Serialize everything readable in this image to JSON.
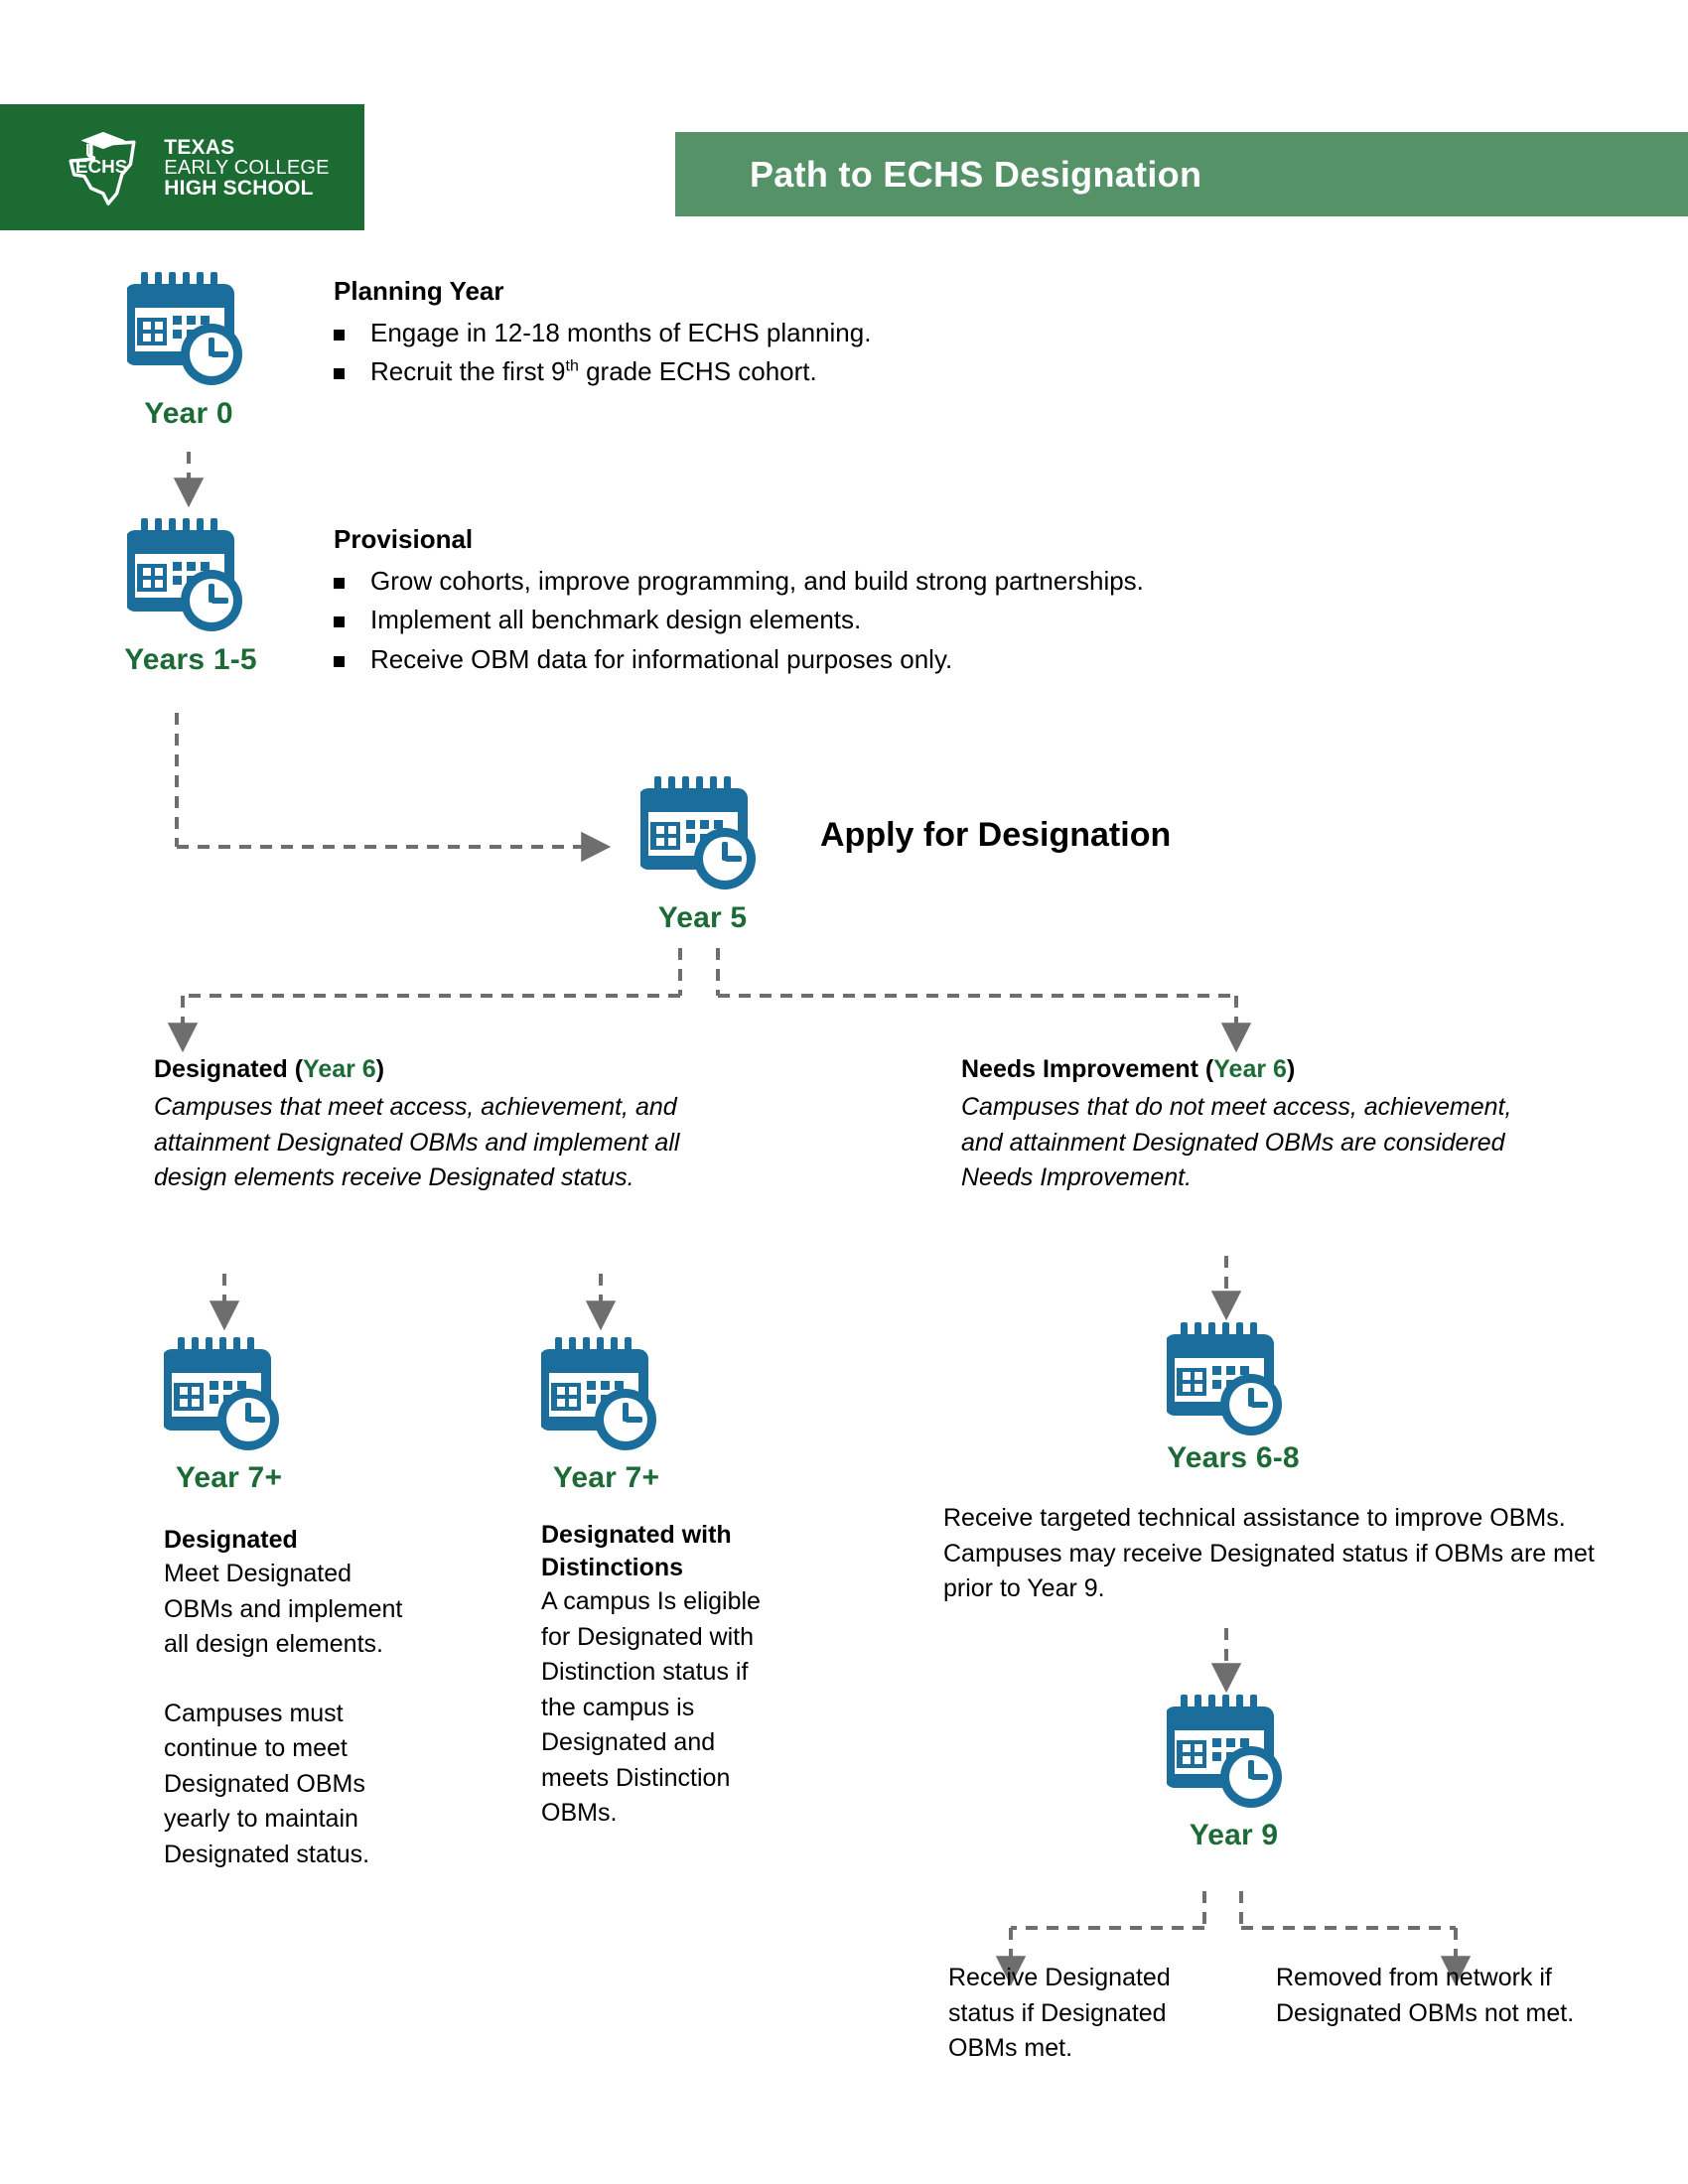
{
  "colors": {
    "logo_green": "#1B6B33",
    "header_green": "#559268",
    "year_green": "#1C6B36",
    "icon_blue": "#1B6E9B",
    "connector_gray": "#6E6E6E"
  },
  "logo": {
    "mark_label": "texas-echs-logo",
    "badge_text": "ECHS",
    "line1": "TEXAS",
    "line2": "EARLY COLLEGE",
    "line3": "HIGH SCHOOL"
  },
  "header": {
    "title": "Path to ECHS Designation"
  },
  "stages": {
    "year0": {
      "icon": "calendar-clock-icon",
      "year_label": "Year 0",
      "heading": "Planning Year",
      "bullets": [
        "Engage in 12-18 months of ECHS planning.",
        "Recruit the first 9th grade ECHS cohort."
      ],
      "bullet2_prefix": "Recruit the first 9",
      "bullet2_sup": "th",
      "bullet2_suffix": " grade ECHS cohort."
    },
    "provisional": {
      "icon": "calendar-clock-icon",
      "year_label": "Years 1-5",
      "heading": "Provisional",
      "bullets": [
        "Grow cohorts, improve programming, and build strong partnerships.",
        "Implement all benchmark design elements.",
        "Receive OBM data for informational purposes only."
      ]
    },
    "apply": {
      "icon": "calendar-clock-icon",
      "year_label": "Year 5",
      "heading": "Apply for Designation"
    },
    "designated_branch": {
      "title_bold": "Designated ",
      "title_paren_open": "(",
      "title_year": "Year 6",
      "title_paren_close": ")",
      "body": "Campuses that meet access, achievement, and attainment Designated OBMs and implement all design elements receive Designated status."
    },
    "needs_improvement_branch": {
      "title_bold": "Needs Improvement ",
      "title_paren_open": "(",
      "title_year": "Year 6",
      "title_paren_close": ")",
      "body": "Campuses that do not meet access, achievement, and attainment Designated OBMs are considered Needs Improvement."
    },
    "designated_col": {
      "icon": "calendar-clock-icon",
      "year_label": "Year 7+",
      "heading": "Designated",
      "para1": "Meet Designated OBMs and implement all design elements.",
      "para2": "Campuses must continue to meet Designated OBMs yearly to maintain Designated status."
    },
    "distinctions_col": {
      "icon": "calendar-clock-icon",
      "year_label": "Year 7+",
      "heading": "Designated with Distinctions",
      "para1": "A campus Is eligible for Designated with Distinction status if the campus is Designated and meets Distinction OBMs."
    },
    "years68": {
      "icon": "calendar-clock-icon",
      "year_label": "Years 6-8",
      "body": "Receive targeted technical assistance to improve OBMs. Campuses may receive Designated status if OBMs are met prior to Year 9."
    },
    "year9": {
      "icon": "calendar-clock-icon",
      "year_label": "Year 9",
      "outcome_left": "Receive Designated status if Designated OBMs met.",
      "outcome_right": "Removed from network if Designated OBMs not met."
    }
  }
}
